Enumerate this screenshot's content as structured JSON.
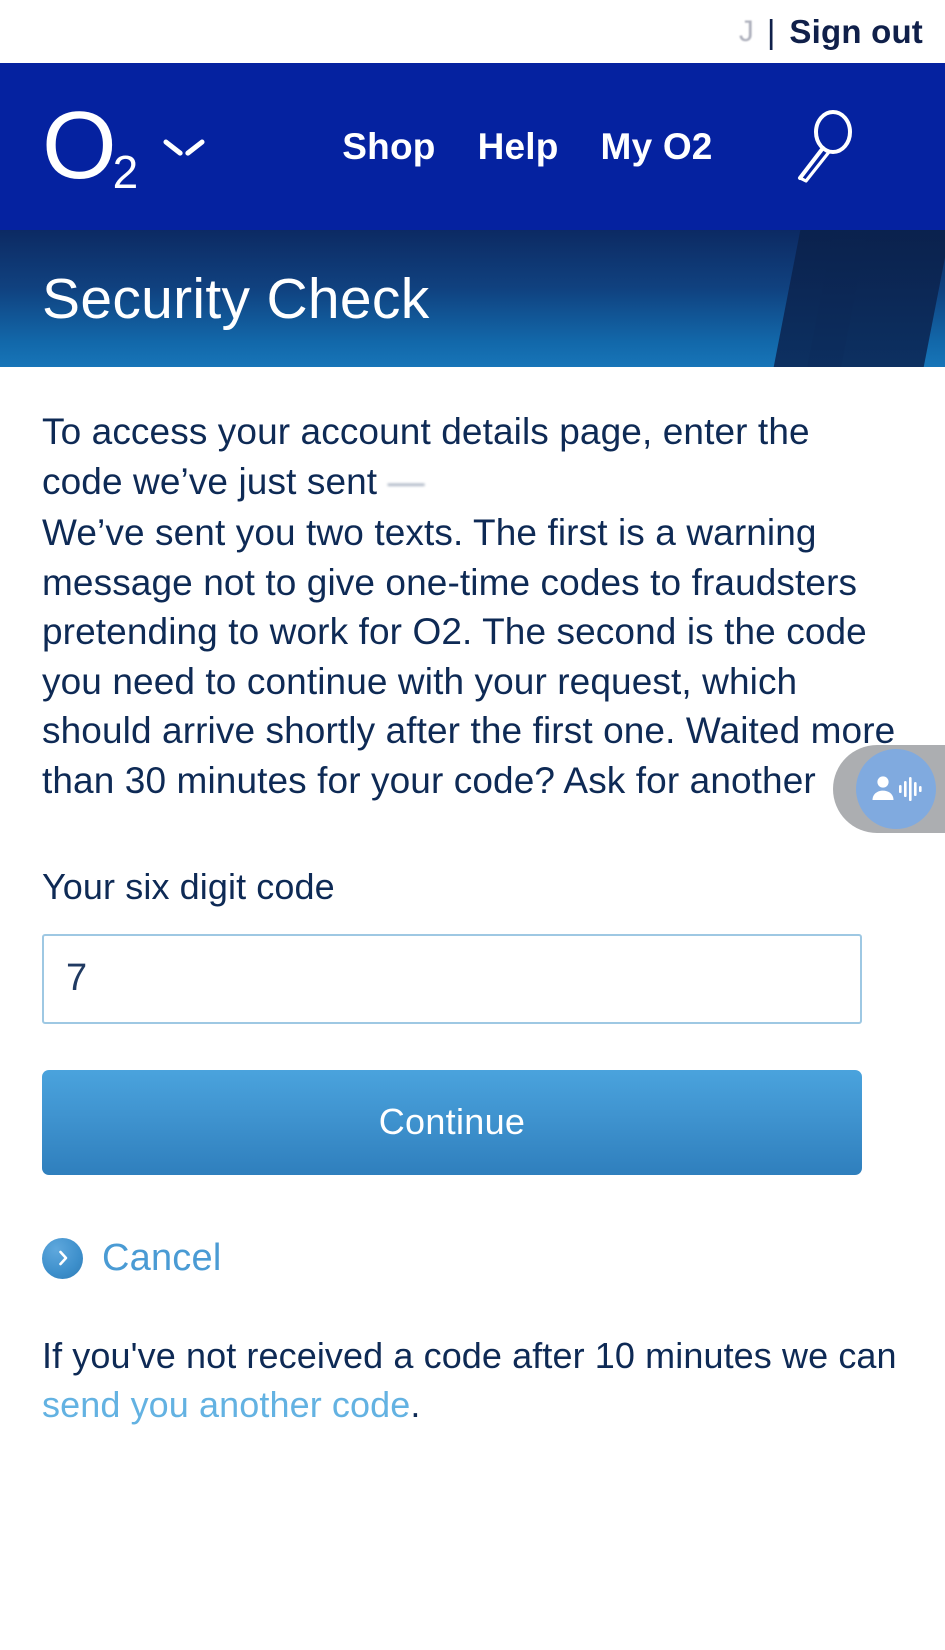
{
  "topbar": {
    "obscured_user": "J",
    "separator": "|",
    "signout_label": "Sign out"
  },
  "nav": {
    "logo_o": "O",
    "logo_sub": "2",
    "chevron_icon": "chevron-down-icon",
    "links": [
      {
        "label": "Shop"
      },
      {
        "label": "Help"
      },
      {
        "label": "My O2"
      }
    ],
    "search_icon": "search-icon",
    "background_color": "#0522a0"
  },
  "banner": {
    "title": "Security Check",
    "gradient_from": "#0c2a63",
    "gradient_to": "#1775b8"
  },
  "main": {
    "intro_line1": "To access your account details page, enter the",
    "intro_line2_prefix": "code we’ve just sent",
    "intro_line2_redacted": "—",
    "intro_body": "We’ve sent you two texts. The first is a warning message not to give one-time codes to fraudsters pretending to work for O2. The second is the code you need to continue with your request, which should arrive shortly after the first one. Waited more than 30 minutes for your code? Ask for another",
    "field_label": "Your six digit code",
    "code_value": "7",
    "code_placeholder": "",
    "continue_label": "Continue",
    "cancel_label": "Cancel",
    "cancel_icon": "chevron-right-circle-icon",
    "footer_text_before": "If you've not received a code after 10 minutes we can ",
    "footer_link": "send you another code",
    "footer_text_after": ".",
    "link_color": "#63b2e2",
    "text_color": "#0e2a55",
    "button_color": "#3f93cf",
    "input_border_color": "#9ec8e3"
  },
  "widget": {
    "name": "accessibility-widget",
    "icon": "person-audio-waveform-icon",
    "badge_color": "#a6a8ab",
    "circle_color": "#76a3dd"
  }
}
